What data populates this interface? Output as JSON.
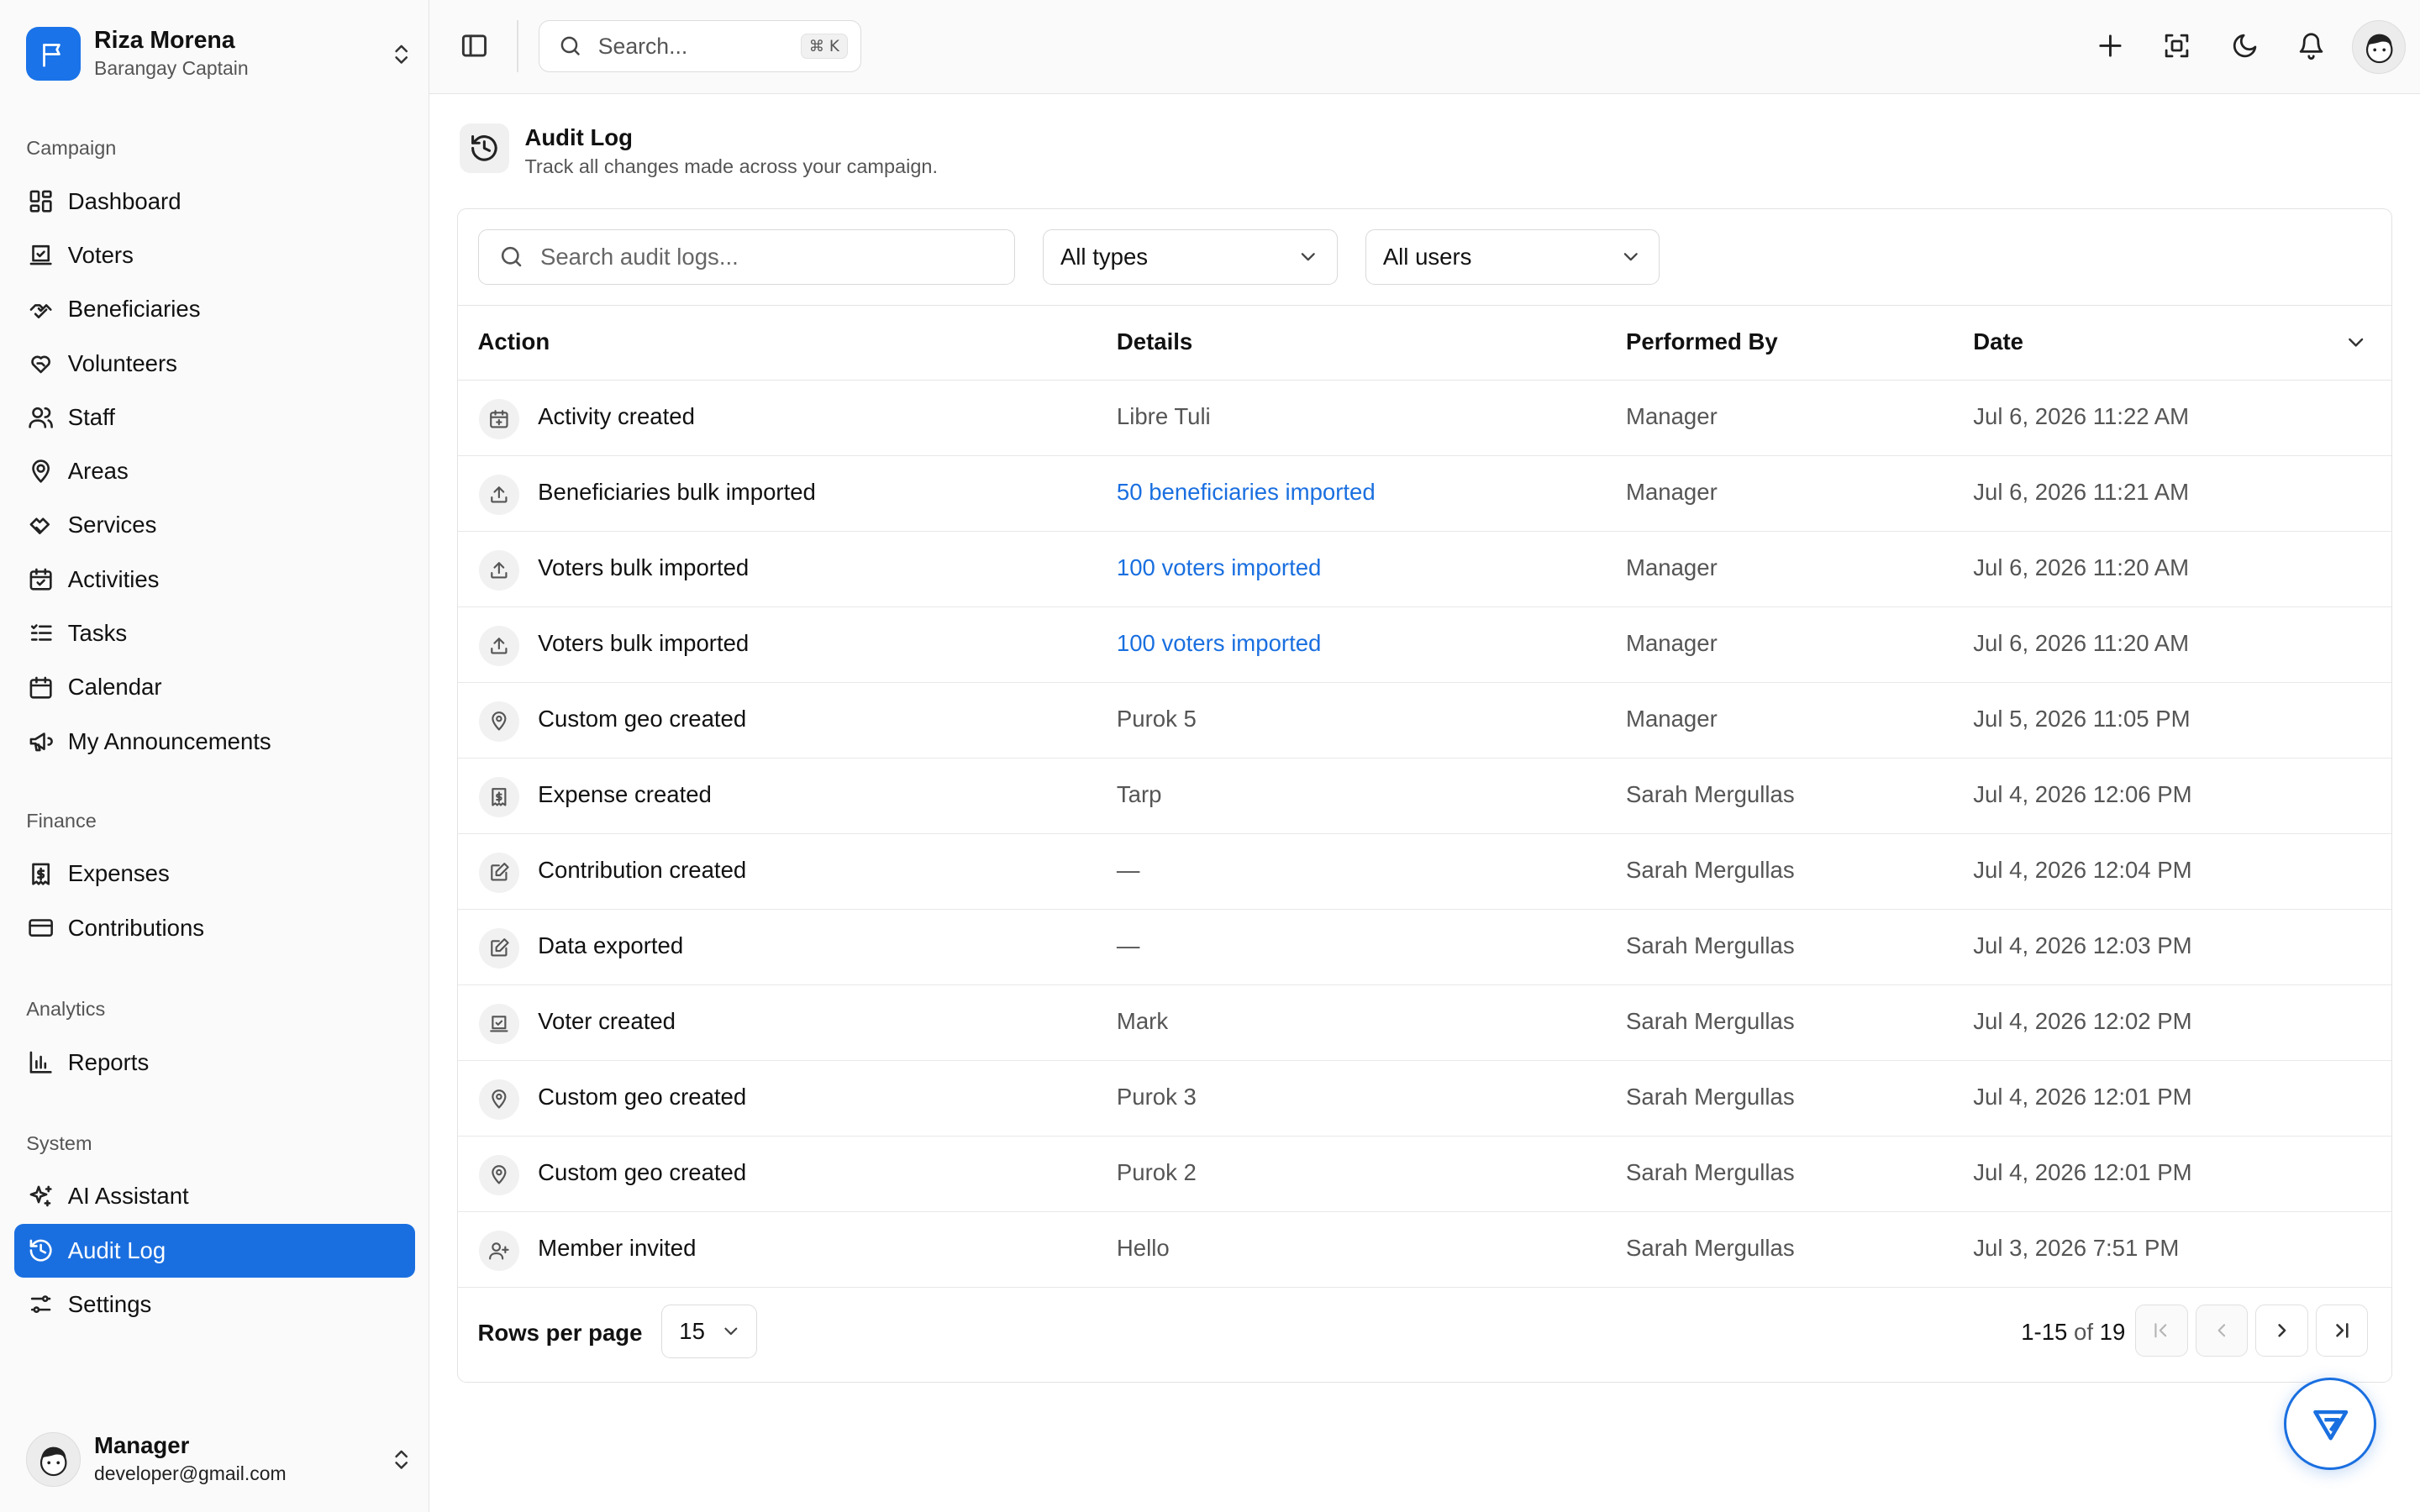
{
  "brand": {
    "name": "Riza Morena",
    "role": "Barangay Captain"
  },
  "sidebar": {
    "groups": [
      {
        "label": "Campaign",
        "items": [
          {
            "label": "Dashboard",
            "icon": "dashboard-icon"
          },
          {
            "label": "Voters",
            "icon": "ballot-icon"
          },
          {
            "label": "Beneficiaries",
            "icon": "handshake-icon"
          },
          {
            "label": "Volunteers",
            "icon": "heart-hand-icon"
          },
          {
            "label": "Staff",
            "icon": "users-icon"
          },
          {
            "label": "Areas",
            "icon": "map-pin-user-icon"
          },
          {
            "label": "Services",
            "icon": "hand-heart-icon"
          },
          {
            "label": "Activities",
            "icon": "calendar-check-icon"
          },
          {
            "label": "Tasks",
            "icon": "list-check-icon"
          },
          {
            "label": "Calendar",
            "icon": "calendar-icon"
          },
          {
            "label": "My Announcements",
            "icon": "megaphone-icon"
          }
        ]
      },
      {
        "label": "Finance",
        "items": [
          {
            "label": "Expenses",
            "icon": "receipt-icon"
          },
          {
            "label": "Contributions",
            "icon": "credit-card-icon"
          }
        ]
      },
      {
        "label": "Analytics",
        "items": [
          {
            "label": "Reports",
            "icon": "bar-chart-icon"
          }
        ]
      },
      {
        "label": "System",
        "items": [
          {
            "label": "AI Assistant",
            "icon": "sparkles-icon"
          },
          {
            "label": "Audit Log",
            "icon": "history-icon",
            "active": true
          },
          {
            "label": "Settings",
            "icon": "sliders-icon"
          }
        ]
      }
    ]
  },
  "user": {
    "name": "Manager",
    "email": "developer@gmail.com"
  },
  "topbar": {
    "search_placeholder": "Search...",
    "shortcut": "⌘ K"
  },
  "page": {
    "title": "Audit Log",
    "subtitle": "Track all changes made across your campaign."
  },
  "filters": {
    "search_placeholder": "Search audit logs...",
    "type_value": "All types",
    "user_value": "All users"
  },
  "table": {
    "headers": {
      "action": "Action",
      "details": "Details",
      "performed_by": "Performed By",
      "date": "Date"
    },
    "rows": [
      {
        "icon": "calendar-plus-icon",
        "action": "Activity created",
        "details": "Libre Tuli",
        "link": false,
        "by": "Manager",
        "date": "Jul 6, 2026 11:22 AM"
      },
      {
        "icon": "upload-icon",
        "action": "Beneficiaries bulk imported",
        "details": "50 beneficiaries imported",
        "link": true,
        "by": "Manager",
        "date": "Jul 6, 2026 11:21 AM"
      },
      {
        "icon": "upload-icon",
        "action": "Voters bulk imported",
        "details": "100 voters imported",
        "link": true,
        "by": "Manager",
        "date": "Jul 6, 2026 11:20 AM"
      },
      {
        "icon": "upload-icon",
        "action": "Voters bulk imported",
        "details": "100 voters imported",
        "link": true,
        "by": "Manager",
        "date": "Jul 6, 2026 11:20 AM"
      },
      {
        "icon": "map-pin-icon",
        "action": "Custom geo created",
        "details": "Purok 5",
        "link": false,
        "by": "Manager",
        "date": "Jul 5, 2026 11:05 PM"
      },
      {
        "icon": "receipt-icon",
        "action": "Expense created",
        "details": "Tarp",
        "link": false,
        "by": "Sarah Mergullas",
        "date": "Jul 4, 2026 12:06 PM"
      },
      {
        "icon": "edit-icon",
        "action": "Contribution created",
        "details": "—",
        "link": false,
        "by": "Sarah Mergullas",
        "date": "Jul 4, 2026 12:04 PM"
      },
      {
        "icon": "edit-icon",
        "action": "Data exported",
        "details": "—",
        "link": false,
        "by": "Sarah Mergullas",
        "date": "Jul 4, 2026 12:03 PM"
      },
      {
        "icon": "ballot-icon",
        "action": "Voter created",
        "details": "Mark",
        "link": false,
        "by": "Sarah Mergullas",
        "date": "Jul 4, 2026 12:02 PM"
      },
      {
        "icon": "map-pin-icon",
        "action": "Custom geo created",
        "details": "Purok 3",
        "link": false,
        "by": "Sarah Mergullas",
        "date": "Jul 4, 2026 12:01 PM"
      },
      {
        "icon": "map-pin-icon",
        "action": "Custom geo created",
        "details": "Purok 2",
        "link": false,
        "by": "Sarah Mergullas",
        "date": "Jul 4, 2026 12:01 PM"
      },
      {
        "icon": "user-plus-icon",
        "action": "Member invited",
        "details": "Hello",
        "link": false,
        "by": "Sarah Mergullas",
        "date": "Jul 3, 2026 7:51 PM"
      }
    ]
  },
  "pagination": {
    "rows_label": "Rows per page",
    "rows_value": "15",
    "range": "1-15",
    "of": "of",
    "total": "19"
  },
  "colors": {
    "accent": "#1a6fe0",
    "link": "#1a6fe0"
  }
}
